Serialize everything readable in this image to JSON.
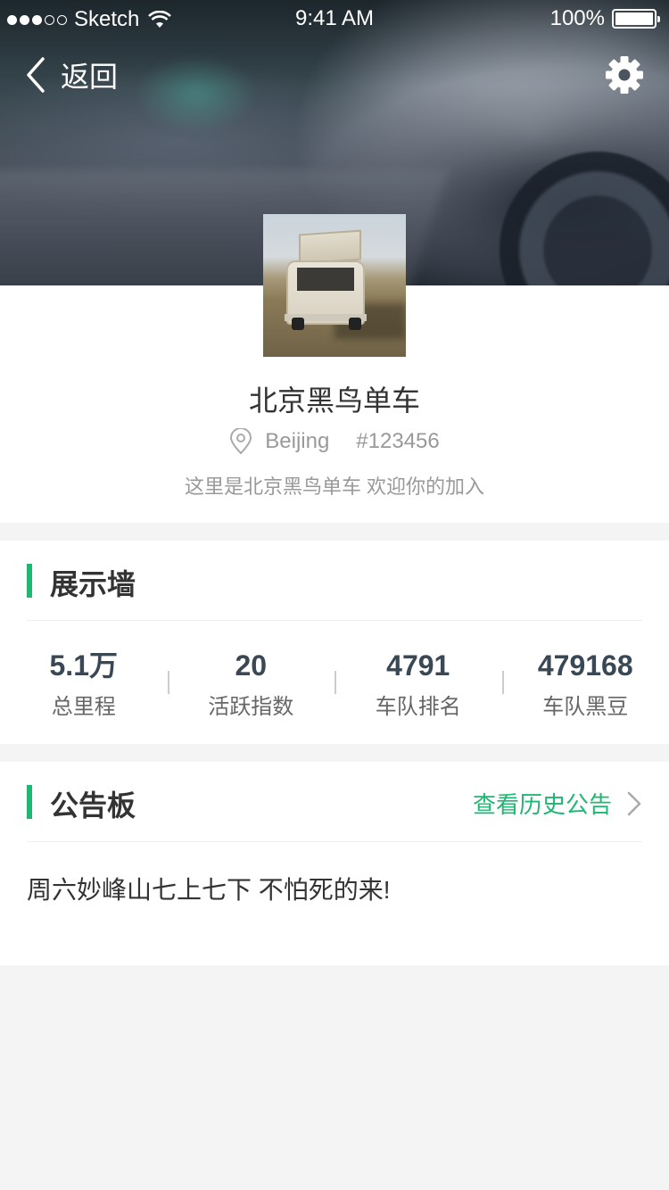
{
  "status_bar": {
    "carrier": "Sketch",
    "time": "9:41 AM",
    "battery": "100%",
    "battery_level": 1.0
  },
  "nav": {
    "back_label": "返回"
  },
  "profile": {
    "name": "北京黑鸟单车",
    "city": "Beijing",
    "team_id": "#123456",
    "intro": "这里是北京黑鸟单车 欢迎你的加入"
  },
  "showcase": {
    "title": "展示墙",
    "stats": [
      {
        "value": "5.1万",
        "label": "总里程"
      },
      {
        "value": "20",
        "label": "活跃指数"
      },
      {
        "value": "4791",
        "label": "车队排名"
      },
      {
        "value": "479168",
        "label": "车队黑豆"
      }
    ]
  },
  "board": {
    "title": "公告板",
    "more_label": "查看历史公告",
    "notice": "周六妙峰山七上七下 不怕死的来!"
  },
  "colors": {
    "accent": "#1fb872",
    "stat_value": "#3a4856",
    "muted_text": "#999999",
    "background": "#f4f4f4"
  }
}
